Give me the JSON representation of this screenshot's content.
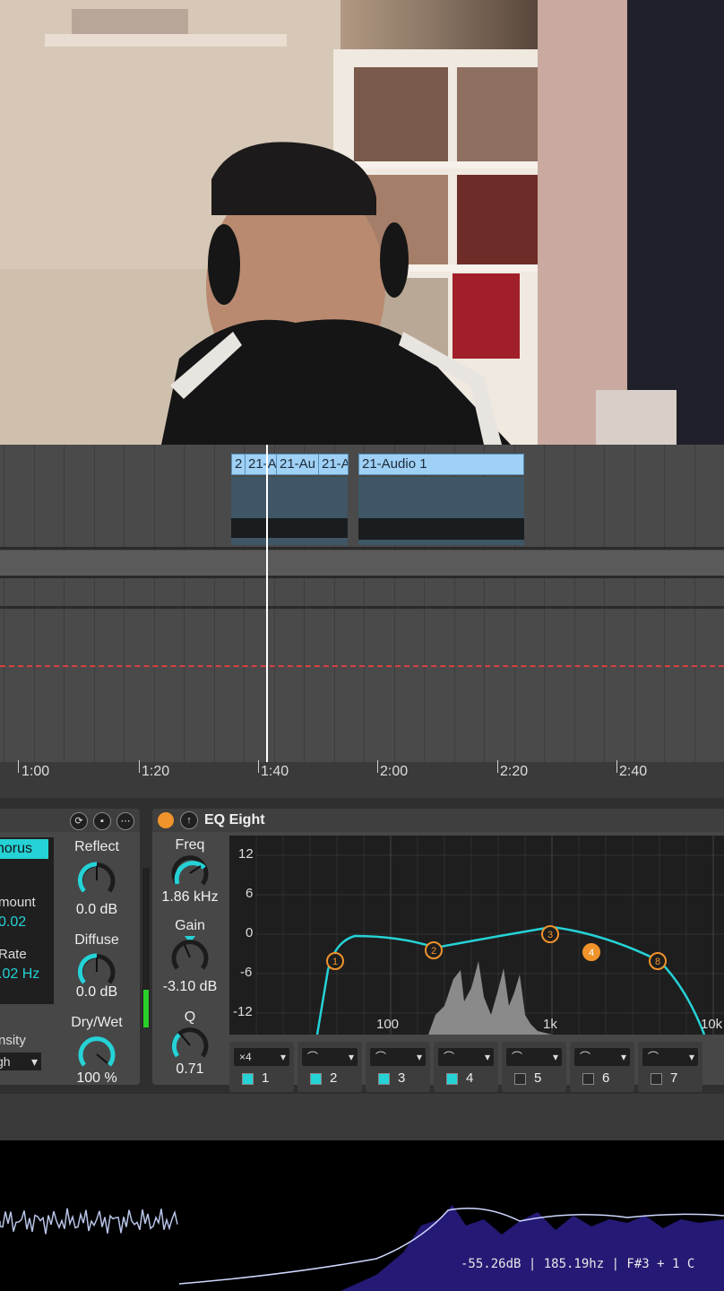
{
  "arrangement": {
    "clips": [
      {
        "label": "2"
      },
      {
        "label": "21-A"
      },
      {
        "label": "21-Au"
      },
      {
        "label": "21-A"
      },
      {
        "label": "21-Audio 1"
      }
    ],
    "ruler": [
      "1:00",
      "1:20",
      "1:40",
      "2:00",
      "2:20",
      "2:40"
    ]
  },
  "chorus": {
    "mode_label": "horus",
    "amount_label": "mount",
    "amount_value": "0.02",
    "rate_label": "Rate",
    "rate_value": ".02 Hz",
    "density_label": "nsity",
    "density_value": "gh",
    "reflect_label": "Reflect",
    "reflect_value": "0.0 dB",
    "diffuse_label": "Diffuse",
    "diffuse_value": "0.0 dB",
    "drywet_label": "Dry/Wet",
    "drywet_value": "100 %"
  },
  "eq": {
    "title": "EQ Eight",
    "freq_label": "Freq",
    "freq_value": "1.86 kHz",
    "gain_label": "Gain",
    "gain_value": "-3.10 dB",
    "q_label": "Q",
    "q_value": "0.71",
    "db_ticks": [
      "12",
      "6",
      "0",
      "-6",
      "-12"
    ],
    "freq_ticks": [
      "100",
      "1k",
      "10k"
    ],
    "bands": [
      {
        "num": "1",
        "on": true,
        "type": "×4"
      },
      {
        "num": "2",
        "on": true,
        "type": ""
      },
      {
        "num": "3",
        "on": true,
        "type": ""
      },
      {
        "num": "4",
        "on": true,
        "type": ""
      },
      {
        "num": "5",
        "on": false,
        "type": ""
      },
      {
        "num": "6",
        "on": false,
        "type": ""
      },
      {
        "num": "7",
        "on": false,
        "type": ""
      }
    ],
    "nodes": [
      "1",
      "2",
      "3",
      "4",
      "8"
    ]
  },
  "analyzer": {
    "readout": "-55.26dB | 185.19hz | F#3 + 1 C"
  },
  "colors": {
    "accent": "#25d2d6",
    "clip": "#9fd0f5",
    "node": "#f0932b",
    "playhead": "#ffffff"
  }
}
